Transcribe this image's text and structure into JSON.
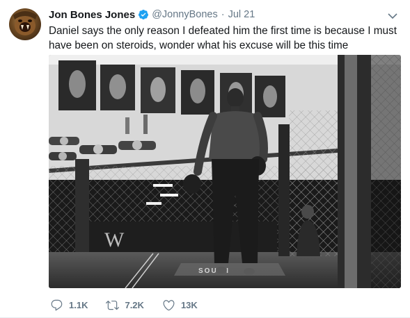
{
  "tweet": {
    "author_name": "Jon Bones Jones",
    "handle": "@JonnyBones",
    "separator": "·",
    "time": "Jul 21",
    "text": "Daniel says the only reason I defeated him the first time is because I must have been on steroids, wonder what his excuse will be this time",
    "verified_color": "#1da1f2",
    "actions": {
      "reply_count": "1.1K",
      "retweet_count": "7.2K",
      "like_count": "13K"
    },
    "icons": [
      "verified-badge-icon",
      "chevron-down-icon",
      "reply-icon",
      "retweet-icon",
      "like-icon"
    ]
  },
  "media": {
    "gym_banner_text": "W",
    "mat_text": "SOUTH"
  }
}
